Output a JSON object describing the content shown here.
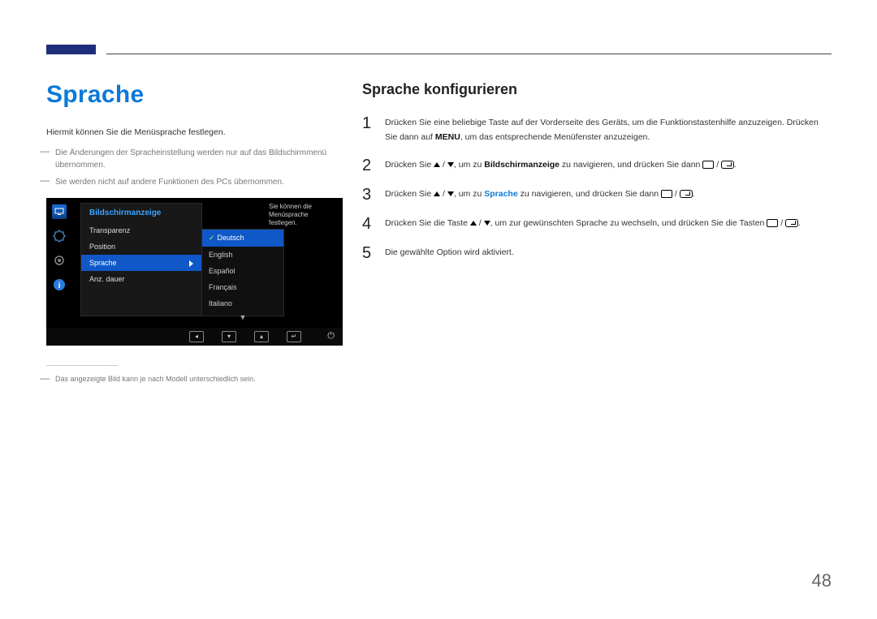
{
  "page_number": "48",
  "left": {
    "title": "Sprache",
    "intro": "Hiermit können Sie die Menüsprache festlegen.",
    "note1": "Die Änderungen der Spracheinstellung werden nur auf das Bildschirmmenü übernommen.",
    "note2": "Sie werden nicht auf andere Funktionen des PCs übernommen.",
    "footnote": "Das angezeigte Bild kann je nach Modell unterschiedlich sein."
  },
  "osd": {
    "menu_title": "Bildschirmanzeige",
    "items": [
      "Transparenz",
      "Position",
      "Sprache",
      "Anz. dauer"
    ],
    "selected_item_index": 2,
    "options": [
      "Deutsch",
      "English",
      "Español",
      "Français",
      "Italiano"
    ],
    "selected_option_index": 0,
    "help_text": "Sie können die Menüsprache festlegen."
  },
  "right": {
    "title": "Sprache konfigurieren",
    "steps": {
      "s1a": "Drücken Sie eine beliebige Taste auf der Vorderseite des Geräts, um die Funktionstastenhilfe anzuzeigen. Drücken Sie dann auf ",
      "s1_menu": "MENU",
      "s1b": ", um das entsprechende Menüfenster anzuzeigen.",
      "s2a": "Drücken Sie ",
      "s2_mid": ", um zu ",
      "s2_target": "Bildschirmanzeige",
      "s2b": " zu navigieren, und drücken Sie dann ",
      "s3_target": "Sprache",
      "s3b": " zu navigieren, und drücken Sie dann ",
      "s4a": "Drücken Sie die Taste ",
      "s4b": ", um zur gewünschten Sprache zu wechseln, und drücken Sie die Tasten ",
      "s5": "Die gewählte Option wird aktiviert.",
      "period": "."
    }
  }
}
